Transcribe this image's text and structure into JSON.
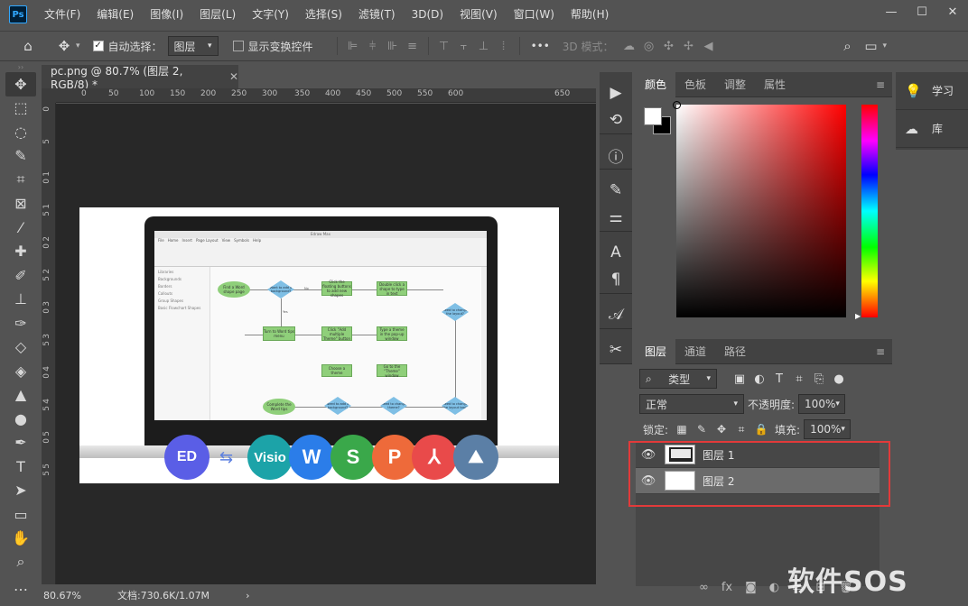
{
  "app": {
    "logo": "Ps"
  },
  "menu": [
    "文件(F)",
    "编辑(E)",
    "图像(I)",
    "图层(L)",
    "文字(Y)",
    "选择(S)",
    "滤镜(T)",
    "3D(D)",
    "视图(V)",
    "窗口(W)",
    "帮助(H)"
  ],
  "window_controls": [
    "—",
    "☐",
    "✕"
  ],
  "options": {
    "auto_select_label": "自动选择：",
    "auto_select_target": "图层",
    "show_transform_label": "显示变换控件",
    "more": "•••",
    "mode_3d_label": "3D 模式："
  },
  "document": {
    "tab_title": "pc.png @ 80.7% (图层 2, RGB/8) *",
    "tab_close": "✕",
    "ruler_h": [
      "0",
      "50",
      "100",
      "150",
      "200",
      "250",
      "300",
      "350",
      "400",
      "450",
      "500",
      "550",
      "600",
      "650"
    ],
    "ruler_v": [
      "0",
      "5",
      "1",
      "0",
      "1",
      "5",
      "2",
      "0",
      "2",
      "5",
      "3",
      "0",
      "3",
      "5",
      "4",
      "0",
      "4",
      "5",
      "5",
      "0",
      "5",
      "5"
    ]
  },
  "artwork": {
    "screen_title": "Edraw Max",
    "tabs": [
      "File",
      "Home",
      "Insert",
      "Page Layout",
      "View",
      "Symbols",
      "Help"
    ],
    "side_items": [
      "Libraries",
      "Backgrounds",
      "Borders",
      "Callouts",
      "Group Shapes",
      "Basic Flowchart Shapes"
    ],
    "flow": {
      "start": "Find a Word shape page",
      "d1": "Want to add a background?",
      "b1": "Click the floating buttons to add new shapes",
      "b2": "Double click a shape to type in text",
      "d2": "Need to change the layout?",
      "b3": "Turn to Word tips menu",
      "b4": "Click \"Add multiple Theme\" button",
      "b5": "Type a theme in the pop-up window",
      "b6": "Choose a theme",
      "b7": "Go to the \"Theme\" window",
      "end": "Complete the Word tips",
      "d3": "Need to add a background?",
      "d4": "Need to change theme?",
      "d5": "Need to change the layout tool?",
      "yes": "Yes",
      "no": "No"
    },
    "icons": [
      {
        "label": "ED",
        "color": "#5a5ee6"
      },
      {
        "label": "Visio",
        "color": "#1ca3a8"
      },
      {
        "label": "W",
        "color": "#2b7de9"
      },
      {
        "label": "S",
        "color": "#3aa84a"
      },
      {
        "label": "P",
        "color": "#ee6a3a"
      },
      {
        "label": "⅄",
        "color": "#e94a4a"
      },
      {
        "label": "⛰",
        "color": "#5b7fa6"
      }
    ],
    "swap_arrows": "⇆"
  },
  "status": {
    "zoom": "80.67%",
    "doc_size": "文档:730.6K/1.07M",
    "arrow": "›"
  },
  "color_panel": {
    "tabs": [
      "颜色",
      "色板",
      "调整",
      "属性"
    ],
    "menu": "≡",
    "foreground": "#ffffff",
    "background": "#000000"
  },
  "layers_panel": {
    "tabs": [
      "图层",
      "通道",
      "路径"
    ],
    "menu": "≡",
    "filter_label": "类型",
    "blend_mode": "正常",
    "opacity_label": "不透明度:",
    "opacity_value": "100%",
    "lock_label": "锁定:",
    "fill_label": "填充:",
    "fill_value": "100%",
    "layers": [
      {
        "name": "图层 1",
        "visible": true,
        "selected": false
      },
      {
        "name": "图层 2",
        "visible": true,
        "selected": true
      }
    ],
    "footer_icons": [
      "∞",
      "fx",
      "◙",
      "◐",
      "▭",
      "⊞",
      "🗑"
    ]
  },
  "right_panel": {
    "items": [
      {
        "label": "学习",
        "icon": "bulb-icon"
      },
      {
        "label": "库",
        "icon": "cloud-icon"
      }
    ]
  },
  "watermark": "软件SOS"
}
